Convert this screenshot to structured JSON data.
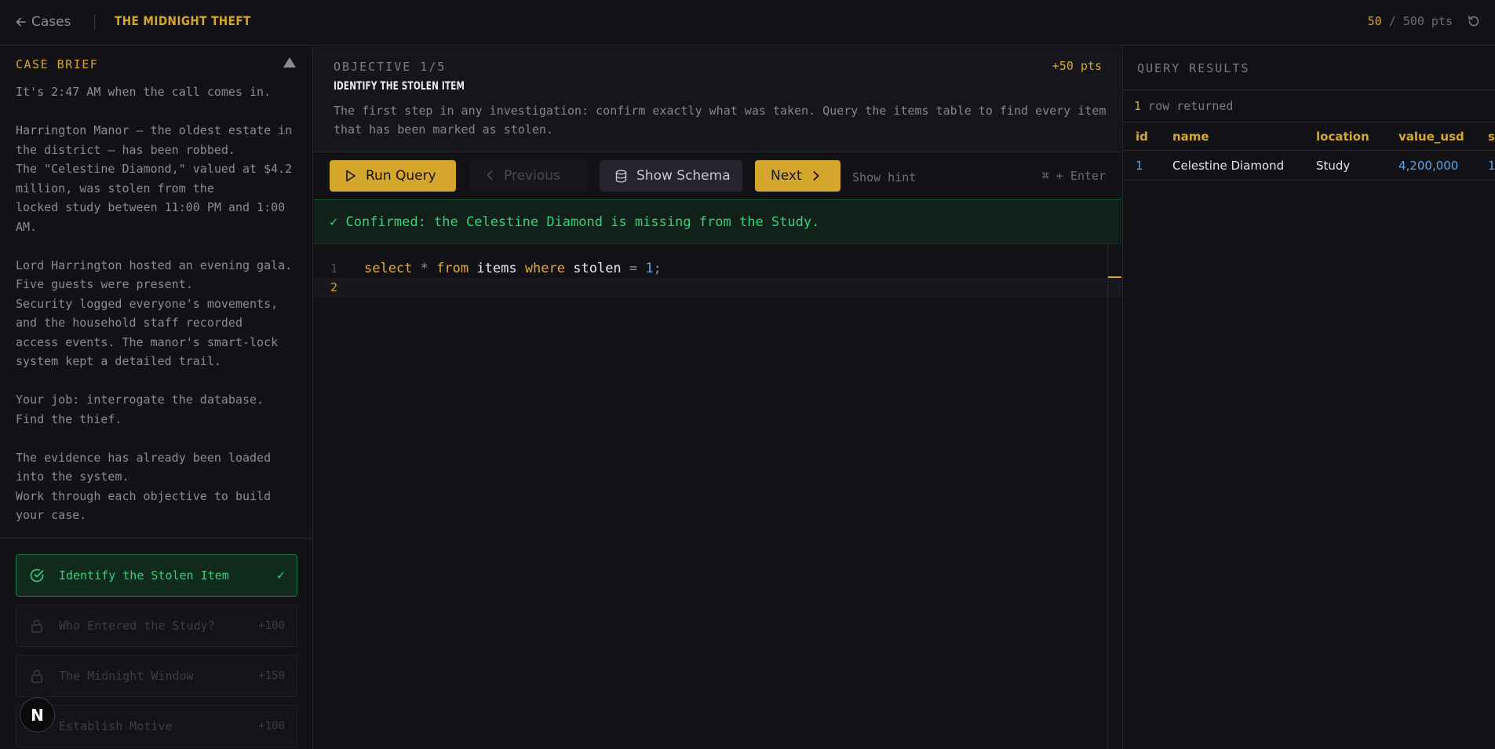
{
  "header": {
    "back_label": "Cases",
    "case_title": "THE MIDNIGHT THEFT",
    "score_current": "50",
    "score_sep": " / ",
    "score_total": "500 pts"
  },
  "brief": {
    "heading": "CASE BRIEF",
    "text": "It's 2:47 AM when the call comes in.\n\nHarrington Manor — the oldest estate in\nthe district — has been robbed.\nThe \"Celestine Diamond,\" valued at $4.2\nmillion, was stolen from the\nlocked study between 11:00 PM and 1:00\nAM.\n\nLord Harrington hosted an evening gala.\nFive guests were present.\nSecurity logged everyone's movements,\nand the household staff recorded\naccess events. The manor's smart-lock\nsystem kept a detailed trail.\n\nYour job: interrogate the database.\nFind the thief.\n\nThe evidence has already been loaded\ninto the system.\nWork through each objective to build\nyour case."
  },
  "objectives": [
    {
      "label": "Identify the Stolen Item",
      "points": "✓",
      "status": "complete"
    },
    {
      "label": "Who Entered the Study?",
      "points": "+100",
      "status": "locked"
    },
    {
      "label": "The Midnight Window",
      "points": "+150",
      "status": "locked"
    },
    {
      "label": "Establish Motive",
      "points": "+100",
      "status": "locked"
    }
  ],
  "current_objective": {
    "number": "OBJECTIVE 1/5",
    "points": "+50 pts",
    "title": "IDENTIFY THE STOLEN ITEM",
    "description": "The first step in any investigation: confirm exactly what was taken. Query the items table to find every item that has been marked as stolen."
  },
  "toolbar": {
    "run_label": "Run Query",
    "prev_label": "Previous",
    "schema_label": "Show Schema",
    "next_label": "Next",
    "hint_label": "Show hint",
    "shortcut": "⌘ + Enter"
  },
  "banner": {
    "text": "✓ Confirmed: the Celestine Diamond is missing from the Study."
  },
  "editor": {
    "lines": [
      "1",
      "2"
    ],
    "tokens": {
      "select": "select",
      "star": "*",
      "from": "from",
      "table": "items",
      "where": "where",
      "col": "stolen",
      "eq": "=",
      "val": "1",
      "semi": ";"
    }
  },
  "results": {
    "heading": "QUERY RESULTS",
    "count": "1",
    "count_suffix": " row returned",
    "columns": [
      "id",
      "name",
      "location",
      "value_usd",
      "s"
    ],
    "rows": [
      [
        "1",
        "Celestine Diamond",
        "Study",
        "4,200,000",
        "1"
      ]
    ]
  },
  "badge": {
    "letter": "N"
  },
  "colors": {
    "accent": "#d4a72c",
    "success": "#33d17a",
    "background": "#111116",
    "number": "#5aa7ee"
  }
}
